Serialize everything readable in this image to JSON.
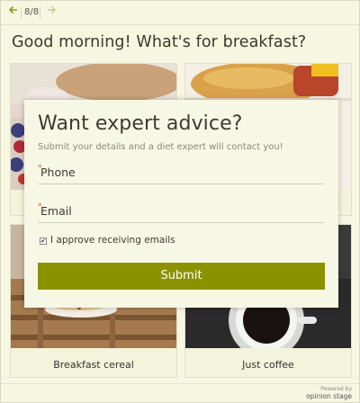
{
  "nav": {
    "prev_icon": "arrow-left-icon",
    "next_icon": "arrow-right-icon",
    "counter": "8/8"
  },
  "question": {
    "title": "Good morning! What's for breakfast?"
  },
  "answers": [
    {
      "label": "",
      "image": "pancakes-berries-photo"
    },
    {
      "label": "",
      "image": "breakfast-sandwich-photo"
    },
    {
      "label": "Breakfast cereal",
      "image": "cereal-bowl-photo"
    },
    {
      "label": "Just coffee",
      "image": "coffee-cup-photo"
    }
  ],
  "modal": {
    "title": "Want expert advice?",
    "subtitle": "Submit your details and a diet expert will contact you!",
    "required_mark": "*",
    "phone_label": "Phone",
    "email_label": "Email",
    "consent_label": "I approve receiving emails",
    "consent_checked": true,
    "consent_check_glyph": "✔",
    "submit_label": "Submit"
  },
  "footer": {
    "powered_by": "Powered by",
    "brand": "opinion stage"
  },
  "colors": {
    "accent": "#8a9200",
    "background": "#f6f6e1",
    "required": "#d2691e"
  }
}
